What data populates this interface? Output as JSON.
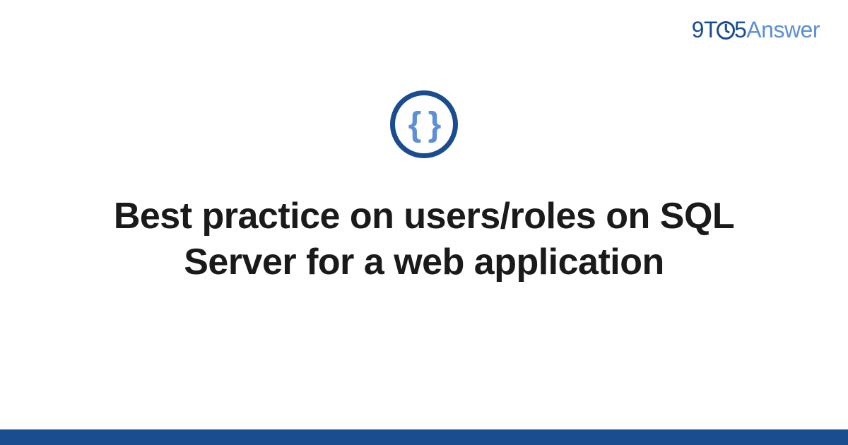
{
  "brand": {
    "part1": "9",
    "part2": "T",
    "part3": "5",
    "part4": "Answer"
  },
  "icon": {
    "symbol": "{ }"
  },
  "title": "Best practice on users/roles on SQL Server for a web application",
  "colors": {
    "primary": "#1a4d8f",
    "accent": "#5b8fd6"
  }
}
